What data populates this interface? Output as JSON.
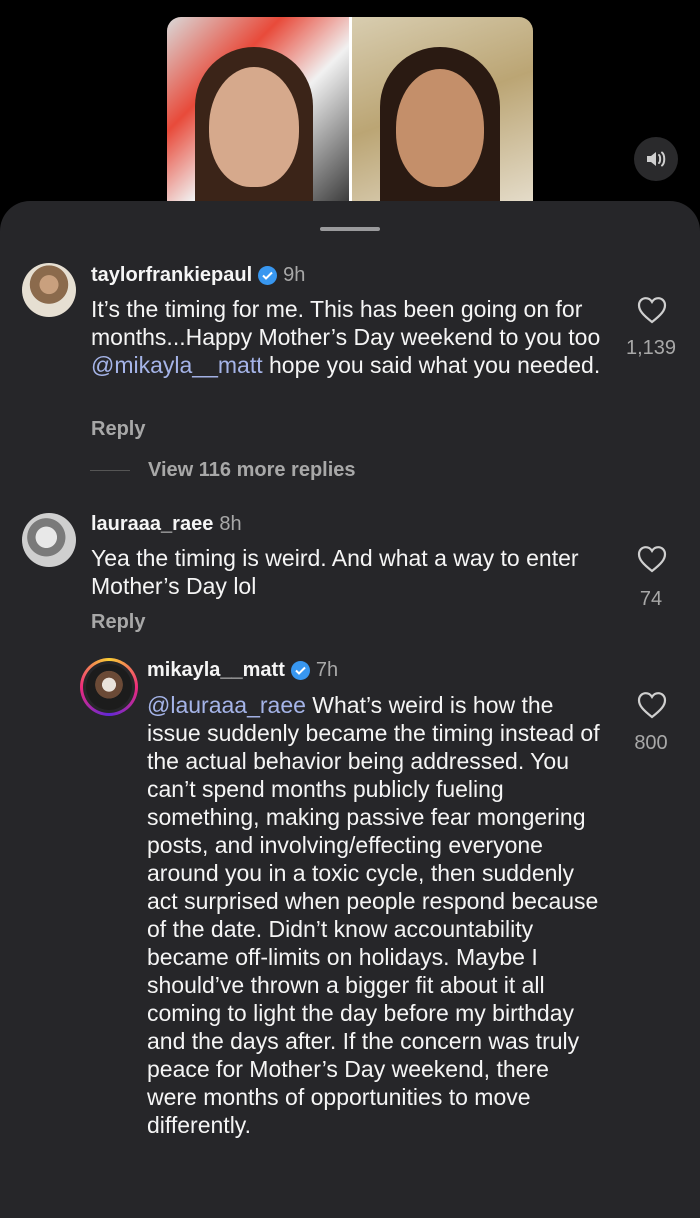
{
  "video": {
    "sound_icon": "speaker-icon"
  },
  "comments": [
    {
      "username": "taylorfrankiepaul",
      "time": "9h",
      "text_parts": [
        "It’s the timing for me. This has been going on for months...Happy Mother’s Day weekend to you too ",
        "@mikayla__matt",
        " hope you said what you needed."
      ],
      "likes": "1,139",
      "reply_label": "Reply",
      "view_replies": "View 116 more replies"
    },
    {
      "username": "lauraaa_raee",
      "time": "8h",
      "text": "Yea the timing is weird. And what a way to enter Mother’s Day lol",
      "likes": "74",
      "reply_label": "Reply"
    },
    {
      "username": "mikayla__matt",
      "time": "7h",
      "mention": "@lauraaa_raee",
      "text": " What’s weird is how the issue suddenly became the timing instead of the actual behavior being addressed. You can’t spend months publicly fueling something, making passive fear mongering posts, and involving/effecting everyone around you in a toxic cycle, then suddenly act surprised when people respond because of the date. Didn’t know accountability became off-limits on holidays. Maybe I should’ve thrown a bigger fit about it all coming to light the day before my birthday and the days after.  If the concern was truly peace for Mother’s Day weekend, there were months of opportunities to move differently.",
      "likes": "800"
    }
  ],
  "colors": {
    "sheet": "#262629",
    "mention": "#a5b4e8",
    "verified": "#3897f0",
    "muted": "#a8a8a8"
  }
}
